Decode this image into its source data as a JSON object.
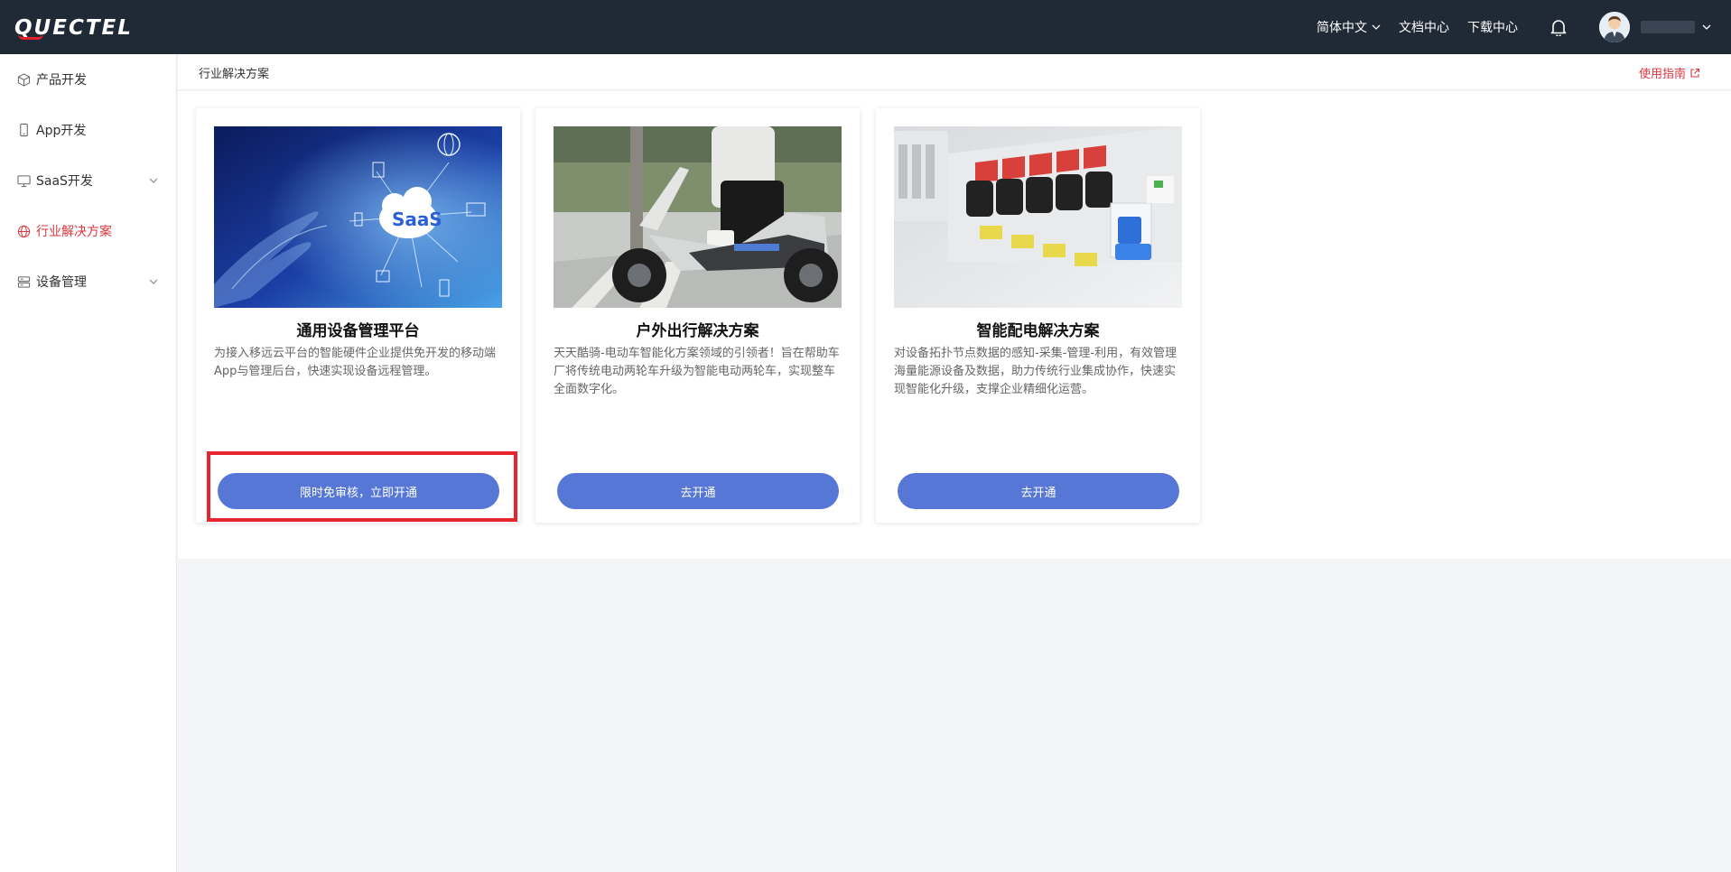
{
  "header": {
    "logo_text": "QUECTEL",
    "nav": [
      {
        "label": "简体中文",
        "has_dropdown": true
      },
      {
        "label": "文档中心",
        "has_dropdown": false
      },
      {
        "label": "下载中心",
        "has_dropdown": false
      }
    ],
    "icons": [
      "bell-icon",
      "avatar"
    ]
  },
  "sidebar": {
    "items": [
      {
        "label": "产品开发",
        "icon": "cube-icon",
        "active": false,
        "expandable": false
      },
      {
        "label": "App开发",
        "icon": "phone-icon",
        "active": false,
        "expandable": false
      },
      {
        "label": "SaaS开发",
        "icon": "monitor-icon",
        "active": false,
        "expandable": true
      },
      {
        "label": "行业解决方案",
        "icon": "globe-icon",
        "active": true,
        "expandable": false
      },
      {
        "label": "设备管理",
        "icon": "server-icon",
        "active": false,
        "expandable": true
      }
    ]
  },
  "page": {
    "title": "行业解决方案",
    "guide_link": "使用指南"
  },
  "cards": [
    {
      "title": "通用设备管理平台",
      "desc": "为接入移远云平台的智能硬件企业提供免开发的移动端App与管理后台，快速实现设备远程管理。",
      "button": "限时免审核，立即开通",
      "image": "saas-cloud-image",
      "image_text": "SaaS"
    },
    {
      "title": "户外出行解决方案",
      "desc": "天天酷骑-电动车智能化方案领域的引领者！旨在帮助车厂将传统电动两轮车升级为智能电动两轮车，实现整车全面数字化。",
      "button": "去开通",
      "image": "electric-scooter-image"
    },
    {
      "title": "智能配电解决方案",
      "desc": "对设备拓扑节点数据的感知-采集-管理-利用，有效管理海量能源设备及数据，助力传统行业集成协作，快速实现智能化升级，支撑企业精细化运营。",
      "button": "去开通",
      "image": "circuit-breaker-image"
    }
  ],
  "colors": {
    "topbar": "#1f2a36",
    "accent_red": "#d9363e",
    "button_blue": "#5777d6",
    "highlight_red": "#e5262f"
  }
}
